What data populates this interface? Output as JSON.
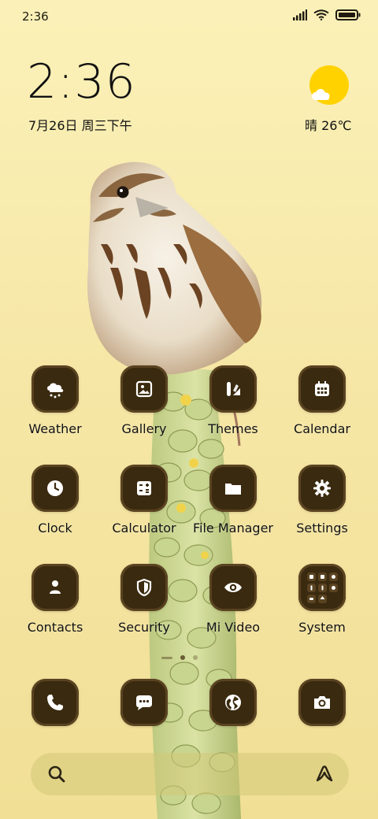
{
  "status_bar": {
    "time": "2:36"
  },
  "lockscreen_widget": {
    "time": "2:36",
    "date": "7月26日 周三下午",
    "weather": "晴 26℃"
  },
  "apps": [
    {
      "label": "Weather",
      "icon": "cloud-rain-icon"
    },
    {
      "label": "Gallery",
      "icon": "image-icon"
    },
    {
      "label": "Themes",
      "icon": "brush-icon"
    },
    {
      "label": "Calendar",
      "icon": "calendar-icon"
    },
    {
      "label": "Clock",
      "icon": "clock-icon"
    },
    {
      "label": "Calculator",
      "icon": "calculator-icon"
    },
    {
      "label": "File Manager",
      "icon": "folder-icon"
    },
    {
      "label": "Settings",
      "icon": "gear-icon"
    },
    {
      "label": "Contacts",
      "icon": "person-icon"
    },
    {
      "label": "Security",
      "icon": "shield-icon"
    },
    {
      "label": "Mi Video",
      "icon": "eye-icon"
    },
    {
      "label": "System",
      "icon": "folder-grid-icon"
    }
  ],
  "dock": [
    {
      "icon": "phone-icon"
    },
    {
      "icon": "message-icon"
    },
    {
      "icon": "globe-icon"
    },
    {
      "icon": "camera-icon"
    }
  ],
  "colors": {
    "tile_bg": "#3a2a0f",
    "tile_border": "#5a4321",
    "sun": "#ffd200"
  }
}
